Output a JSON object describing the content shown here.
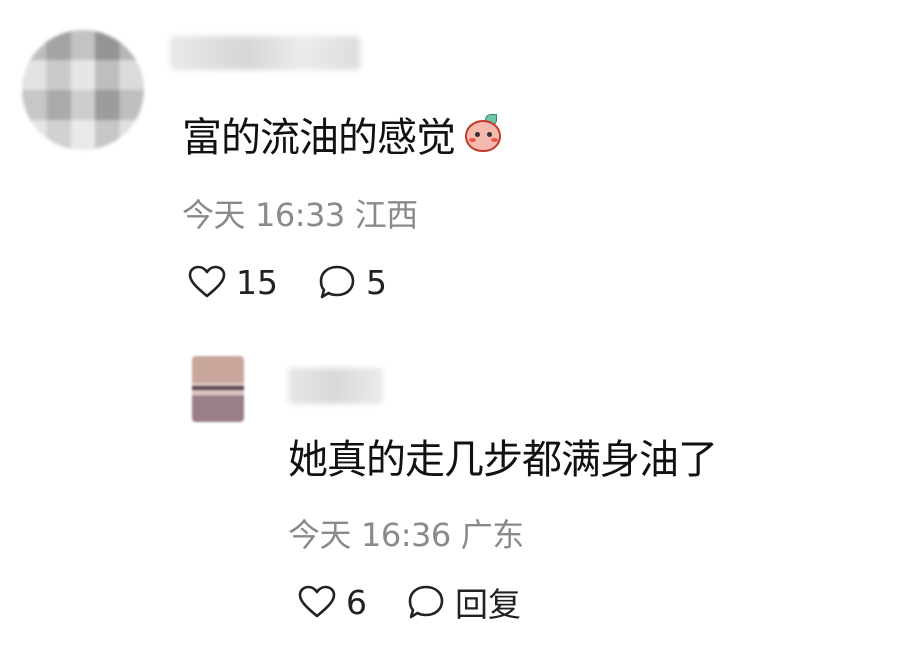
{
  "comment": {
    "text": "富的流油的感觉",
    "emoji_icon": "peach-face-emoji",
    "date": "今天",
    "time": "16:33",
    "location": "江西",
    "likes": "15",
    "replies": "5"
  },
  "reply": {
    "text": "她真的走几步都满身油了",
    "date": "今天",
    "time": "16:36",
    "location": "广东",
    "likes": "6",
    "reply_label": "回复"
  },
  "icons": {
    "like": "heart-outline-icon",
    "comment": "chat-bubble-outline-icon"
  }
}
